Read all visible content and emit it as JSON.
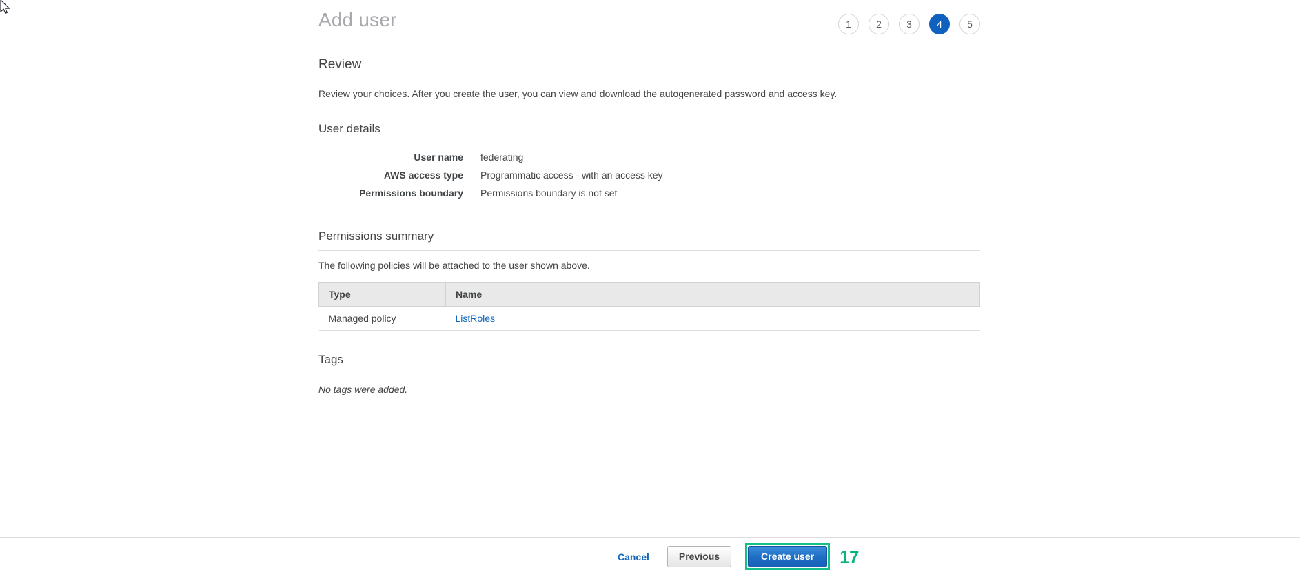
{
  "window": {
    "page_title": "Add user"
  },
  "wizard": {
    "steps": [
      {
        "label": "1",
        "active": false
      },
      {
        "label": "2",
        "active": false
      },
      {
        "label": "3",
        "active": false
      },
      {
        "label": "4",
        "active": true
      },
      {
        "label": "5",
        "active": false
      }
    ],
    "active_step": "4"
  },
  "review": {
    "heading": "Review",
    "description": "Review your choices. After you create the user, you can view and download the autogenerated password and access key."
  },
  "user_details": {
    "heading": "User details",
    "rows": [
      {
        "label": "User name",
        "value": "federating"
      },
      {
        "label": "AWS access type",
        "value": "Programmatic access - with an access key"
      },
      {
        "label": "Permissions boundary",
        "value": "Permissions boundary is not set"
      }
    ]
  },
  "permissions_summary": {
    "heading": "Permissions summary",
    "description": "The following policies will be attached to the user shown above.",
    "columns": [
      "Type",
      "Name"
    ],
    "rows": [
      {
        "type": "Managed policy",
        "name": "ListRoles"
      }
    ]
  },
  "tags": {
    "heading": "Tags",
    "empty_text": "No tags were added."
  },
  "footer": {
    "cancel_label": "Cancel",
    "previous_label": "Previous",
    "create_label": "Create user",
    "annotation_number": "17"
  },
  "colors": {
    "accent_blue": "#1060bf",
    "link_blue": "#1166bb",
    "highlight_green": "#14c08a",
    "annotation_green": "#09b47c",
    "title_gray": "#a7a9ac",
    "table_header_bg": "#e9e9e9"
  },
  "icons": {
    "cursor": "mouse-pointer-icon"
  }
}
